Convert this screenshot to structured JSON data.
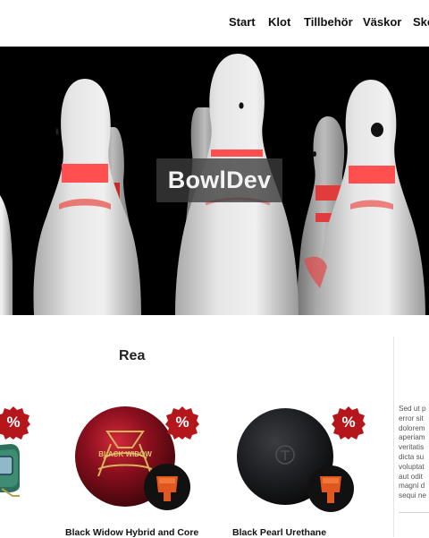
{
  "nav": {
    "items": [
      "Start",
      "Klot",
      "Tillbehör",
      "Väskor",
      "Sko"
    ]
  },
  "hero": {
    "brand": "BowlDev"
  },
  "sale": {
    "title": "Rea",
    "badge_symbol": "%",
    "products": [
      {
        "name": ""
      },
      {
        "name": "Black Widow Hybrid and Core"
      },
      {
        "name": "Black Pearl Urethane"
      }
    ]
  },
  "sidebar": {
    "lines": [
      "Sed ut p",
      "error sit",
      "dolorem",
      "aperiam",
      "veritatis",
      "dicta su",
      "voluptat",
      "aut odit",
      "magni d",
      "sequi ne"
    ]
  },
  "colors": {
    "badge": "#b5161c",
    "accent_red": "#ff4f4f",
    "orange_core": "#e0571f"
  }
}
